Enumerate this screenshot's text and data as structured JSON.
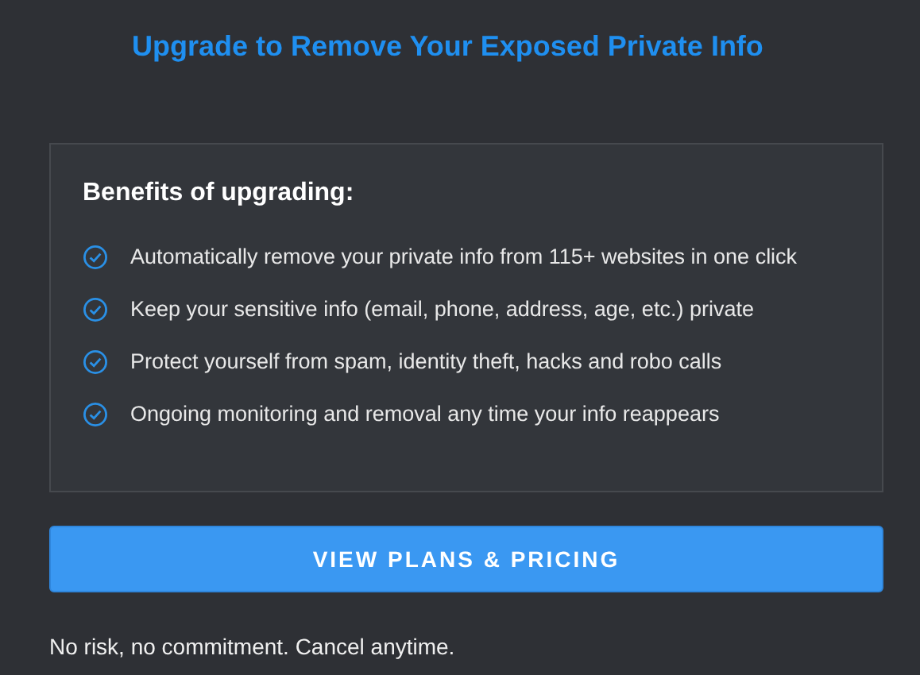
{
  "title": "Upgrade to Remove Your Exposed Private Info",
  "benefits": {
    "heading": "Benefits of upgrading:",
    "items": [
      {
        "text": "Automatically remove your private info from 115+ websites in one click"
      },
      {
        "text": "Keep your sensitive info (email, phone, address, age, etc.) private"
      },
      {
        "text": "Protect yourself from spam, identity theft, hacks and robo calls"
      },
      {
        "text": "Ongoing monitoring and removal any time your info reappears"
      }
    ]
  },
  "button": "VIEW PLANS & PRICING",
  "footnote": "No risk, no commitment. Cancel anytime."
}
